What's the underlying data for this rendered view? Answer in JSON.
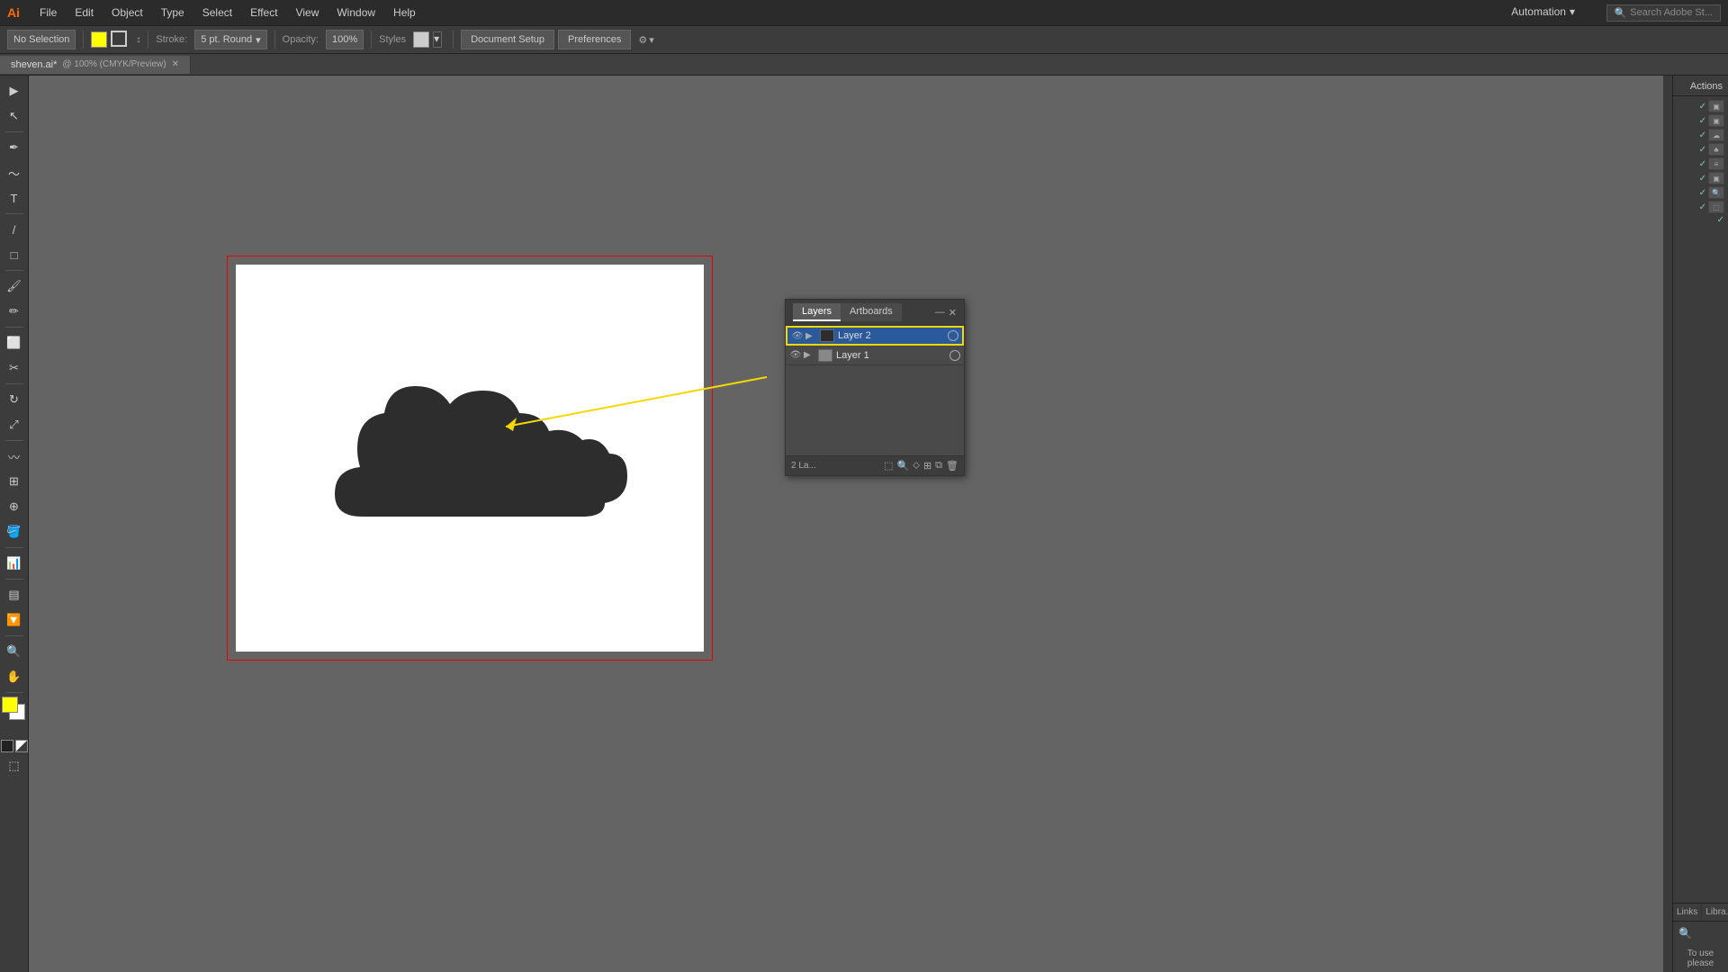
{
  "app": {
    "logo": "Ai",
    "automation_label": "Automation",
    "search_placeholder": "Search Adobe St..."
  },
  "menu": {
    "items": [
      "File",
      "Edit",
      "Object",
      "Type",
      "Select",
      "Effect",
      "View",
      "Window",
      "Help"
    ]
  },
  "toolbar": {
    "no_selection": "No Selection",
    "stroke_label": "Stroke:",
    "stroke_value": "5 pt. Round",
    "opacity_label": "Opacity:",
    "opacity_value": "100%",
    "styles_label": "Styles",
    "document_setup": "Document Setup",
    "preferences": "Preferences"
  },
  "doc_tab": {
    "name": "sheven.ai*",
    "info": "@ 100% (CMYK/Preview)"
  },
  "layers_panel": {
    "title": "Layers",
    "tabs": [
      "Layers",
      "Artboards"
    ],
    "layers": [
      {
        "name": "Layer 2",
        "selected": true,
        "eye": true
      },
      {
        "name": "Layer 1",
        "selected": false,
        "eye": true
      }
    ],
    "count": "2 La...",
    "footer_buttons": [
      "new-layer",
      "new-sublayer",
      "move-selection",
      "merge",
      "delete"
    ]
  },
  "actions_panel": {
    "title": "Actions",
    "bottom_tabs": [
      "Links",
      "Libra..."
    ],
    "to_use_text": "To use please"
  }
}
